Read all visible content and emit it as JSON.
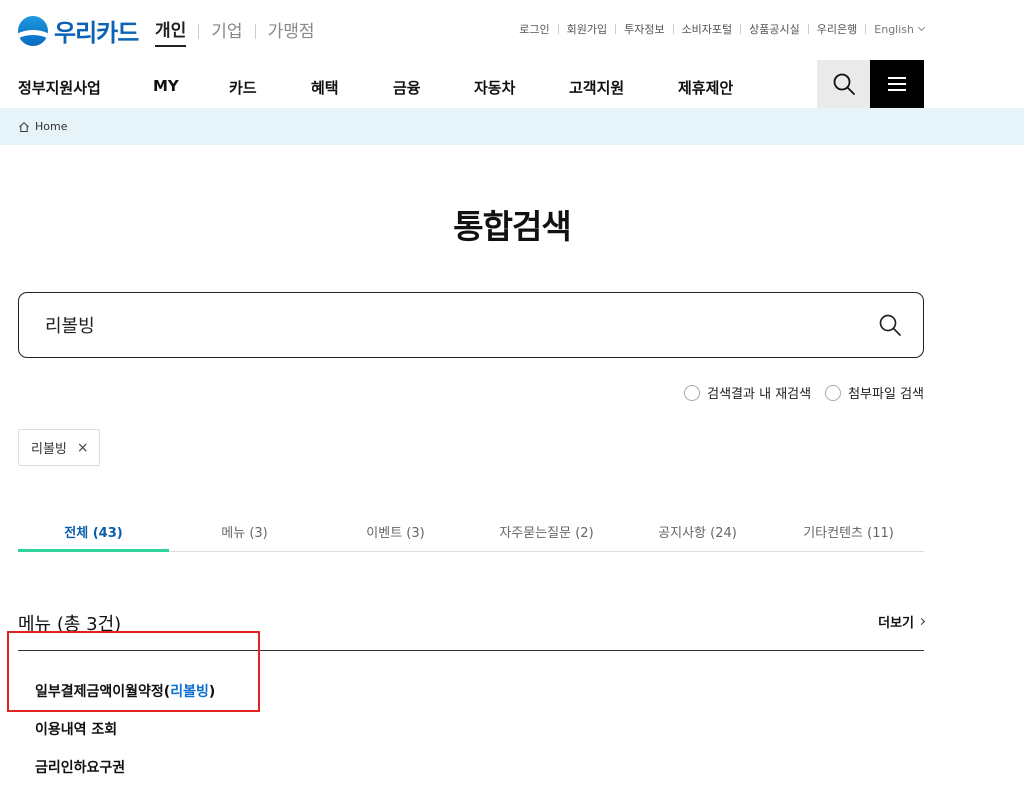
{
  "brand": {
    "logo_text": "우리카드"
  },
  "segments": [
    {
      "label": "개인",
      "active": true
    },
    {
      "label": "기업",
      "active": false
    },
    {
      "label": "가맹점",
      "active": false
    }
  ],
  "utility": [
    "로그인",
    "회원가입",
    "투자정보",
    "소비자포털",
    "상품공시실",
    "우리은행"
  ],
  "language": "English",
  "gnb": [
    "정부지원사업",
    "MY",
    "카드",
    "혜택",
    "금융",
    "자동차",
    "고객지원",
    "제휴제안"
  ],
  "breadcrumb": {
    "home": "Home"
  },
  "page_title": "통합검색",
  "search": {
    "value": "리볼빙"
  },
  "options": [
    {
      "label": "검색결과 내 재검색"
    },
    {
      "label": "첨부파일 검색"
    }
  ],
  "chip": {
    "label": "리볼빙",
    "remove": "×"
  },
  "tabs": [
    {
      "label": "전체 (43)",
      "active": true
    },
    {
      "label": "메뉴 (3)",
      "active": false
    },
    {
      "label": "이벤트 (3)",
      "active": false
    },
    {
      "label": "자주묻는질문 (2)",
      "active": false
    },
    {
      "label": "공지사항 (24)",
      "active": false
    },
    {
      "label": "기타컨텐츠 (11)",
      "active": false
    }
  ],
  "section": {
    "title": "메뉴 (총 3건)",
    "more": "더보기"
  },
  "results": [
    {
      "prefix": "일부결제금액이월약정(",
      "highlight": "리볼빙",
      "suffix": ")"
    },
    {
      "prefix": "이용내역 조회",
      "highlight": "",
      "suffix": ""
    },
    {
      "prefix": "금리인하요구권",
      "highlight": "",
      "suffix": ""
    }
  ],
  "colors": {
    "brand": "#0b63b6",
    "active_tab_underline": "#2fd3a0",
    "highlight_box": "#e02424"
  }
}
